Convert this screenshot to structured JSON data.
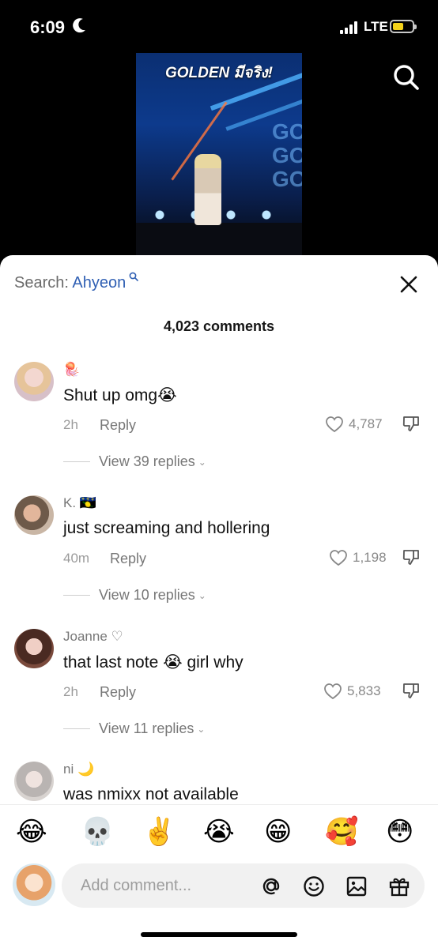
{
  "status_bar": {
    "time": "6:09",
    "network": "LTE"
  },
  "video": {
    "overlay_title": "GOLDEN มีจริง!",
    "stage_text": "GO GO GO"
  },
  "sheet": {
    "search_prefix": "Search: ",
    "search_query": "Ahyeon",
    "comment_count": "4,023 comments"
  },
  "comments": [
    {
      "name": "🪼",
      "text": "Shut up omg😭",
      "time": "2h",
      "reply": "Reply",
      "likes": "4,787",
      "view_replies": "View 39 replies"
    },
    {
      "name": "K. 🇬🇵",
      "text": "just screaming and hollering",
      "time": "40m",
      "reply": "Reply",
      "likes": "1,198",
      "view_replies": "View 10 replies"
    },
    {
      "name": "Joanne ♡",
      "text": "that last note 😭 girl why",
      "time": "2h",
      "reply": "Reply",
      "likes": "5,833",
      "view_replies": "View 11 replies"
    },
    {
      "name": "ni 🌙",
      "text": "was nmixx not available"
    }
  ],
  "emojis": [
    "😂",
    "💀",
    "✌️",
    "😭",
    "😁",
    "🥰",
    "😳"
  ],
  "input": {
    "placeholder": "Add comment..."
  },
  "colors": {
    "link_blue": "#2f5fb3",
    "battery_yellow": "#f4d21b"
  }
}
